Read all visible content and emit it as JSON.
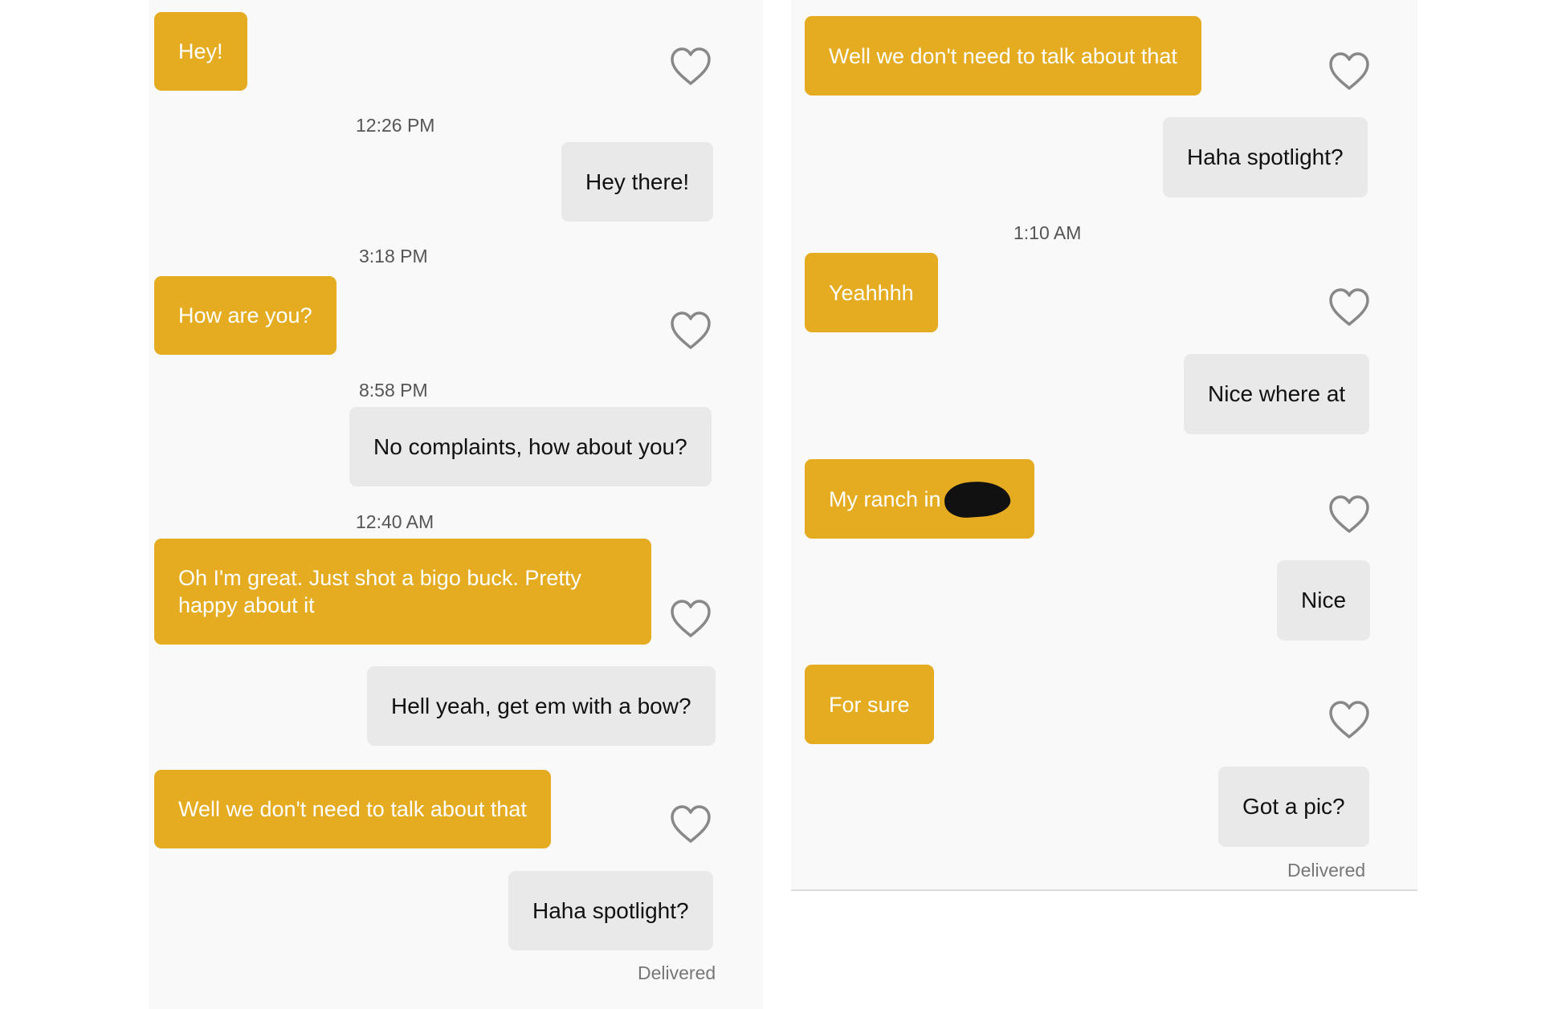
{
  "left_chat": {
    "msg1": "Hey!",
    "time1": "12:26 PM",
    "msg2": "Hey there!",
    "time2": "3:18 PM",
    "msg3": "How are you?",
    "time3": "8:58 PM",
    "msg4": "No complaints, how about you?",
    "time4": "12:40 AM",
    "msg5": "Oh I'm great. Just shot a bigo buck. Pretty happy about it",
    "msg6": "Hell yeah, get em with a bow?",
    "msg7": "Well we don't need to talk about that",
    "msg8": "Haha spotlight?",
    "status": "Delivered"
  },
  "right_chat": {
    "msg1": "Well we don't need to talk about that",
    "msg2": "Haha spotlight?",
    "time1": "1:10 AM",
    "msg3": "Yeahhhh",
    "msg4": "Nice where at",
    "msg5": "My ranch in",
    "msg6": "Nice",
    "msg7": "For sure",
    "msg8": "Got a pic?",
    "status": "Delivered"
  },
  "icons": {
    "like": "heart-outline-icon",
    "redaction": "redaction-mark"
  },
  "colors": {
    "sent_bubble": "#e5ab21",
    "received_bubble": "#e9e9e9",
    "background": "#f9f9f9",
    "heart": "#888888"
  }
}
